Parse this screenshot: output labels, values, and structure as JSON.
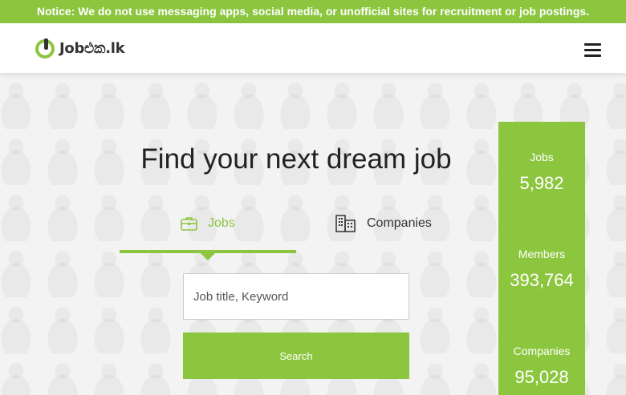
{
  "notice": {
    "text": "Notice: We do not use messaging apps, social media, or unofficial sites for recruitment or job postings."
  },
  "navbar": {
    "logo_text": "Jobඑක.lk",
    "menu_icon": "hamburger-menu-icon"
  },
  "hero": {
    "title": "Find your next dream job",
    "tabs": [
      {
        "label": "Jobs",
        "icon": "briefcase-icon",
        "active": true
      },
      {
        "label": "Companies",
        "icon": "building-icon",
        "active": false
      }
    ],
    "search": {
      "placeholder": "Job title, Keyword",
      "value": "",
      "button_label": "Search"
    }
  },
  "stats": [
    {
      "label": "Jobs",
      "value": "5,982"
    },
    {
      "label": "Members",
      "value": "393,764"
    },
    {
      "label": "Companies",
      "value": "95,028"
    }
  ],
  "colors": {
    "accent": "#8cc63f",
    "text_dark": "#222222",
    "navbar_bg": "#ffffff"
  }
}
